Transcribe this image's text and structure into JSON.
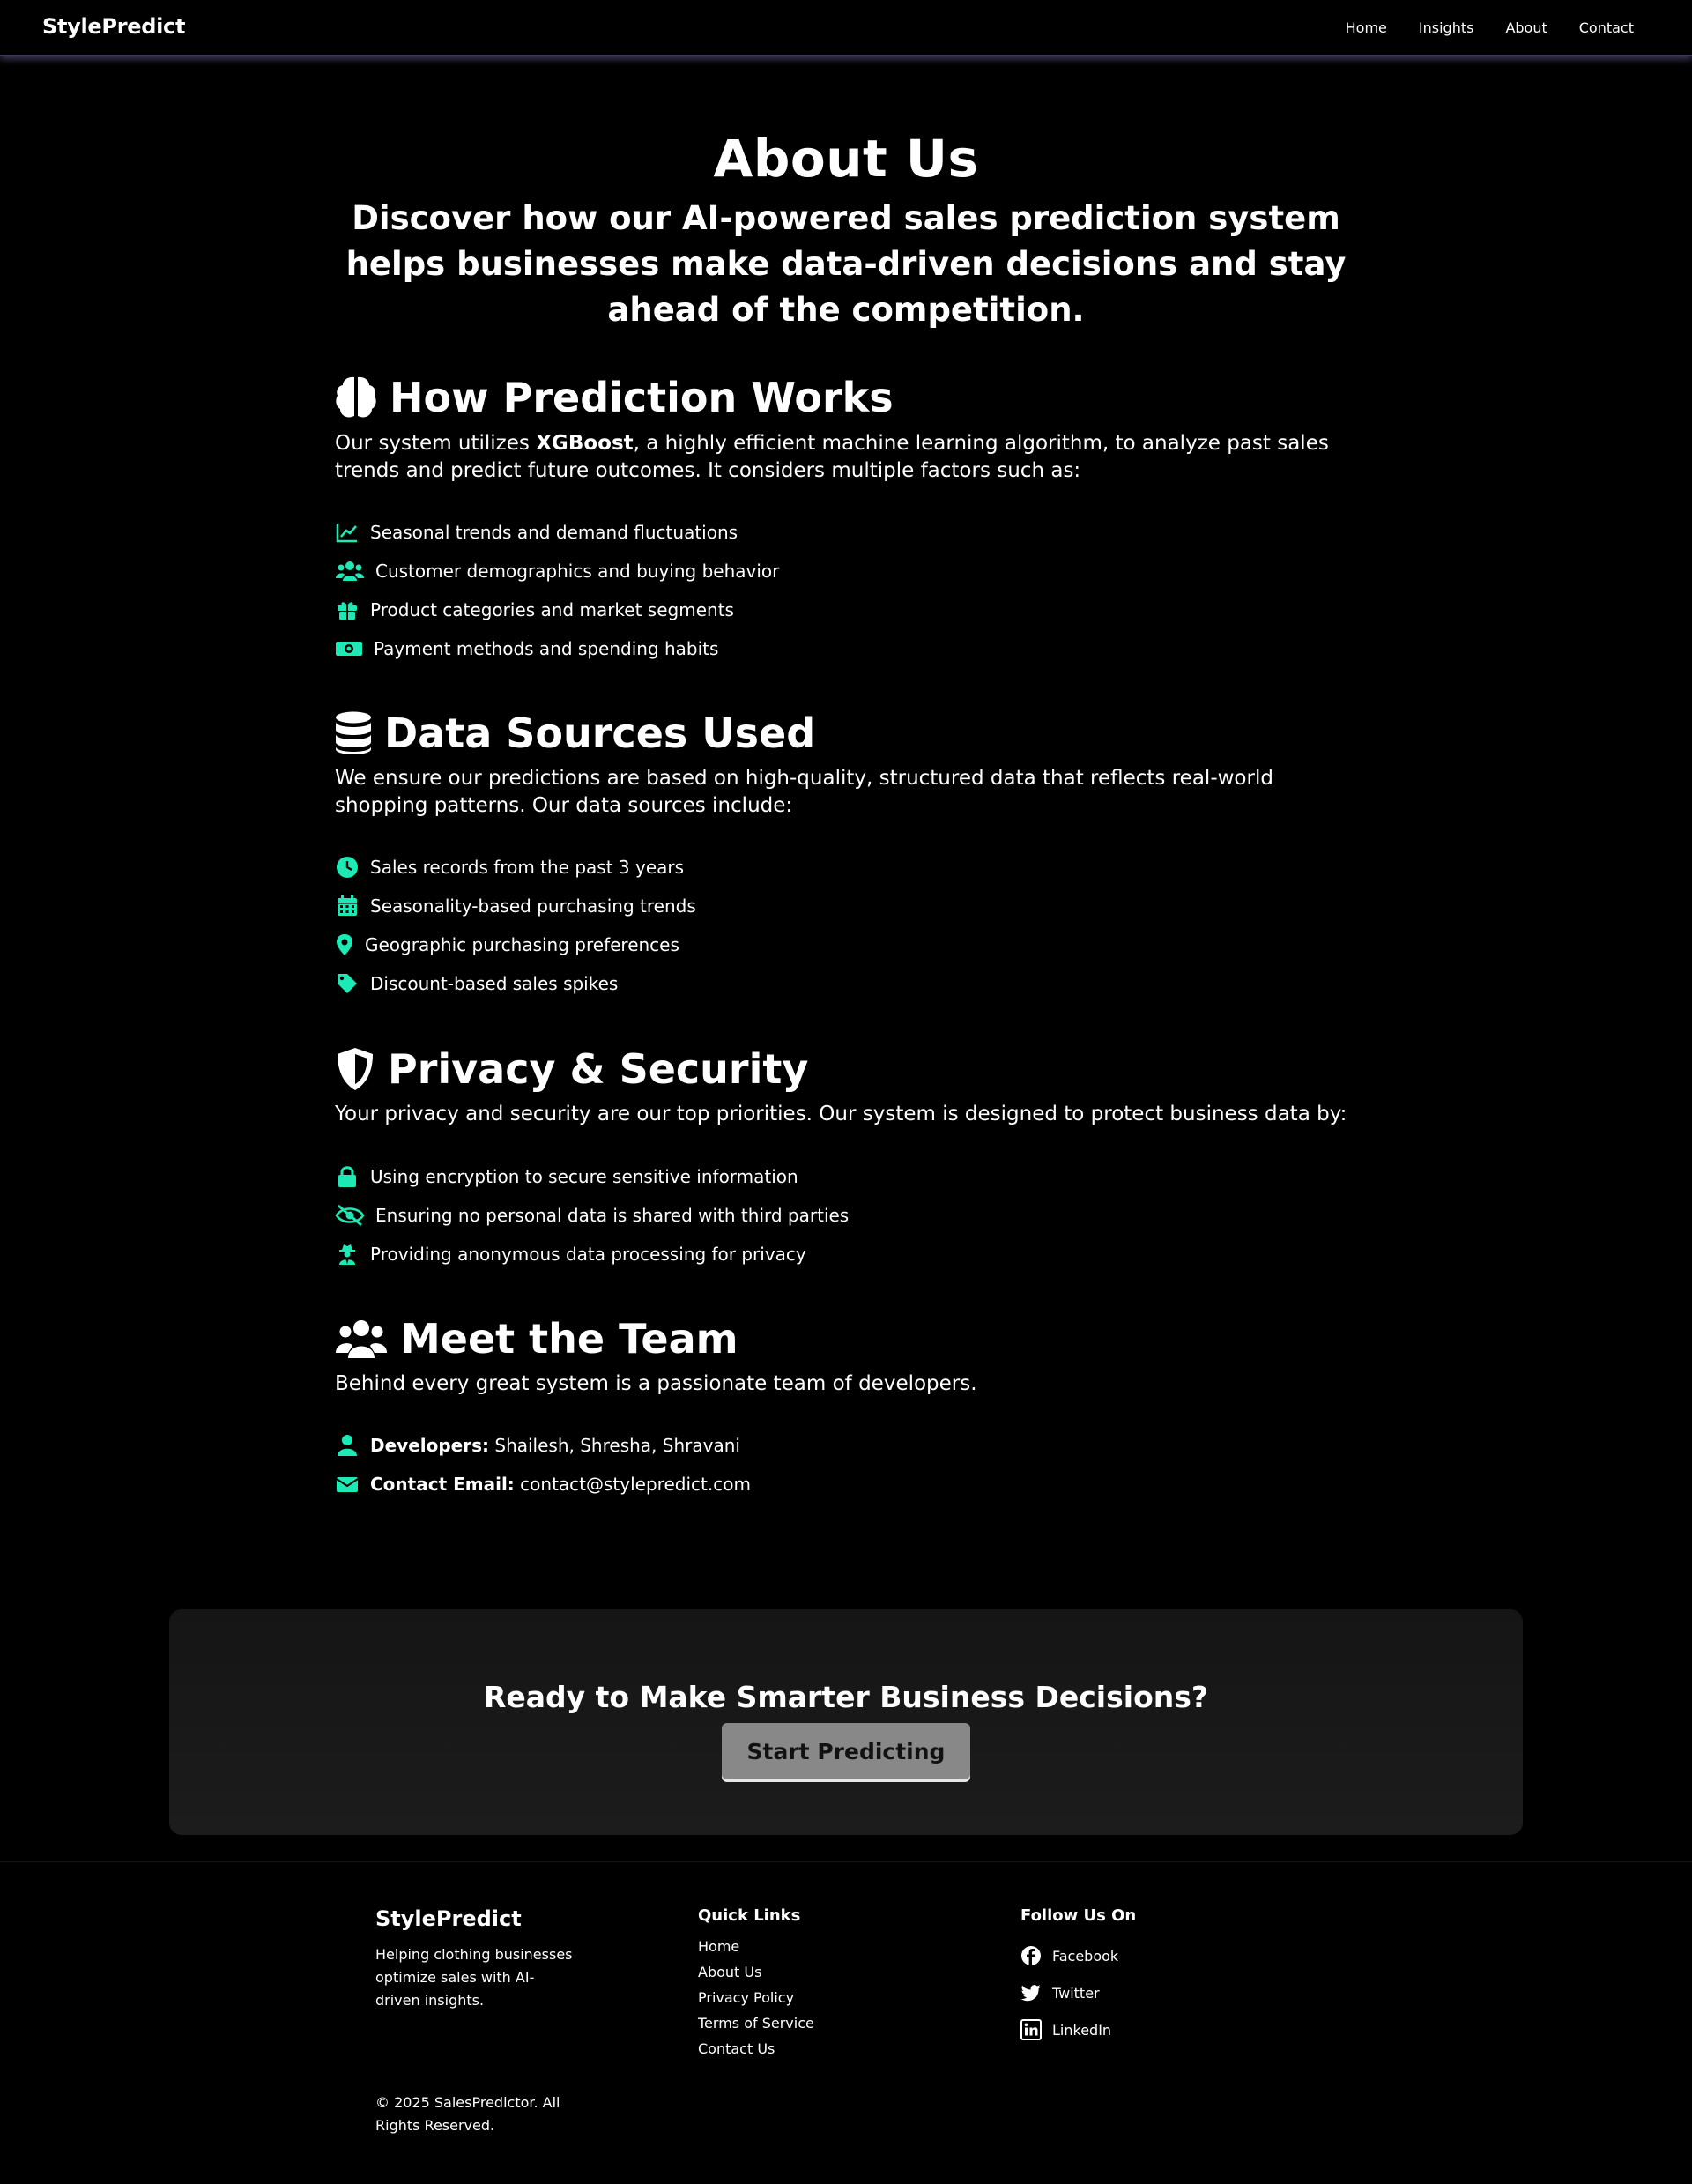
{
  "nav": {
    "brand": "StylePredict",
    "links": [
      "Home",
      "Insights",
      "About",
      "Contact"
    ]
  },
  "hero": {
    "title": "About Us",
    "subtitle": "Discover how our AI-powered sales prediction system helps businesses make data-driven decisions and stay ahead of the competition."
  },
  "prediction": {
    "heading": "How Prediction Works",
    "icon": "brain-icon",
    "text_before": "Our system utilizes ",
    "text_bold": "XGBoost",
    "text_after": ", a highly efficient machine learning algorithm, to analyze past sales trends and predict future outcomes. It considers multiple factors such as:",
    "items": [
      {
        "icon": "chart-line-icon",
        "label": "Seasonal trends and demand fluctuations"
      },
      {
        "icon": "users-icon",
        "label": "Customer demographics and buying behavior"
      },
      {
        "icon": "gift-icon",
        "label": "Product categories and market segments"
      },
      {
        "icon": "money-bill-icon",
        "label": "Payment methods and spending habits"
      }
    ]
  },
  "sources": {
    "heading": "Data Sources Used",
    "icon": "database-icon",
    "text": "We ensure our predictions are based on high-quality, structured data that reflects real-world shopping patterns. Our data sources include:",
    "items": [
      {
        "icon": "clock-icon",
        "label": "Sales records from the past 3 years"
      },
      {
        "icon": "calendar-icon",
        "label": "Seasonality-based purchasing trends"
      },
      {
        "icon": "map-pin-icon",
        "label": "Geographic purchasing preferences"
      },
      {
        "icon": "tag-icon",
        "label": "Discount-based sales spikes"
      }
    ]
  },
  "privacy": {
    "heading": "Privacy & Security",
    "icon": "shield-icon",
    "text": "Your privacy and security are our top priorities. Our system is designed to protect business data by:",
    "items": [
      {
        "icon": "lock-icon",
        "label": "Using encryption to secure sensitive information"
      },
      {
        "icon": "eye-slash-icon",
        "label": "Ensuring no personal data is shared with third parties"
      },
      {
        "icon": "user-secret-icon",
        "label": "Providing anonymous data processing for privacy"
      }
    ]
  },
  "team": {
    "heading": "Meet the Team",
    "icon": "users-icon",
    "text": "Behind every great system is a passionate team of developers.",
    "developers_label": "Developers:",
    "developers_value": "Shailesh, Shresha, Shravani",
    "email_label": "Contact Email:",
    "email_value": "contact@stylepredict.com"
  },
  "cta": {
    "title": "Ready to Make Smarter Business Decisions?",
    "button": "Start Predicting"
  },
  "footer": {
    "brand": "StylePredict",
    "description": "Helping clothing businesses optimize sales with AI-driven insights.",
    "copyright": "© 2025 SalesPredictor. All Rights Reserved.",
    "quick_links_title": "Quick Links",
    "quick_links": [
      "Home",
      "About Us",
      "Privacy Policy",
      "Terms of Service",
      "Contact Us"
    ],
    "follow_title": "Follow Us On",
    "social": [
      {
        "icon": "facebook-icon",
        "label": "Facebook"
      },
      {
        "icon": "twitter-icon",
        "label": "Twitter"
      },
      {
        "icon": "linkedin-icon",
        "label": "LinkedIn"
      }
    ]
  },
  "colors": {
    "accent": "#1de9b6",
    "background": "#000000",
    "cta_panel": "#1a1a1a",
    "button": "#888888"
  }
}
